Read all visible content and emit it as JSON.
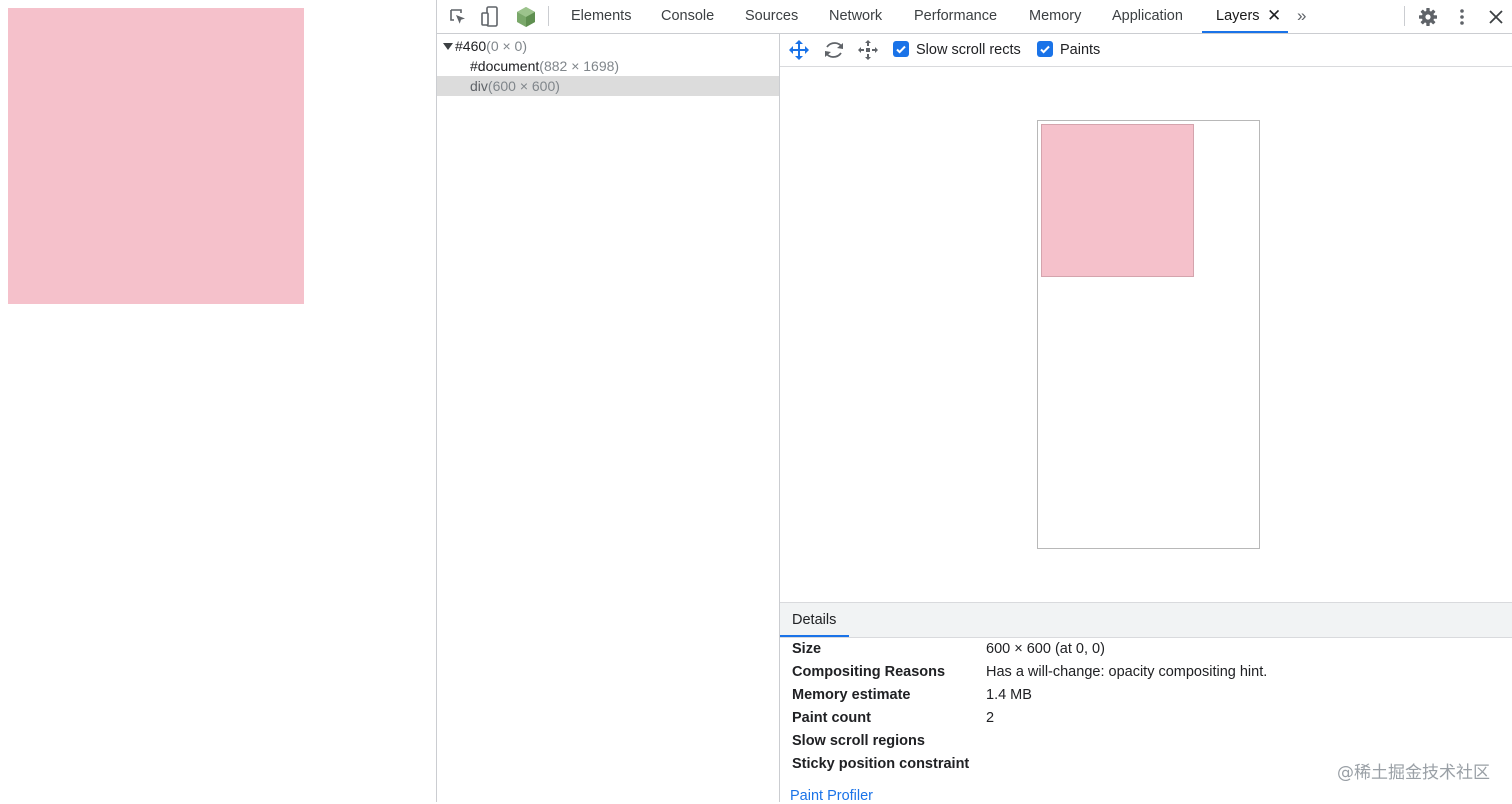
{
  "page": {
    "block_color": "#f5c1cb"
  },
  "devtools": {
    "tabs": [
      {
        "label": "Elements"
      },
      {
        "label": "Console"
      },
      {
        "label": "Sources"
      },
      {
        "label": "Network"
      },
      {
        "label": "Performance"
      },
      {
        "label": "Memory"
      },
      {
        "label": "Application"
      },
      {
        "label": "Layers",
        "active": true
      }
    ],
    "close_glyph": "✕",
    "more_tabs_glyph": "»",
    "icons": [
      "inspect-element-icon",
      "device-toolbar-icon",
      "node-cube-icon",
      "gear-icon",
      "kebab-menu-icon",
      "close-devtools-icon"
    ],
    "accent": "#1a73e8"
  },
  "layer_tree": {
    "rows": [
      {
        "name": "#460",
        "dims": "(0 × 0)"
      },
      {
        "name": "#document",
        "dims": "(882 × 1698)"
      },
      {
        "name": "div",
        "dims": "(600 × 600)",
        "selected": true
      }
    ]
  },
  "layers_toolbar": {
    "tools": [
      "pan-tool-icon",
      "rotate-tool-icon",
      "reset-transform-icon"
    ],
    "checkboxes": [
      {
        "label": "Slow scroll rects",
        "checked": true
      },
      {
        "label": "Paints",
        "checked": true
      }
    ]
  },
  "details": {
    "tab_label": "Details",
    "rows": [
      {
        "label": "Size",
        "value": "600 × 600 (at 0, 0)"
      },
      {
        "label": "Compositing Reasons",
        "value": "Has a will-change: opacity compositing hint."
      },
      {
        "label": "Memory estimate",
        "value": "1.4 MB"
      },
      {
        "label": "Paint count",
        "value": "2"
      },
      {
        "label": "Slow scroll regions",
        "value": ""
      },
      {
        "label": "Sticky position constraint",
        "value": ""
      }
    ],
    "paint_profiler_link": "Paint Profiler"
  },
  "watermark": "@稀土掘金技术社区"
}
